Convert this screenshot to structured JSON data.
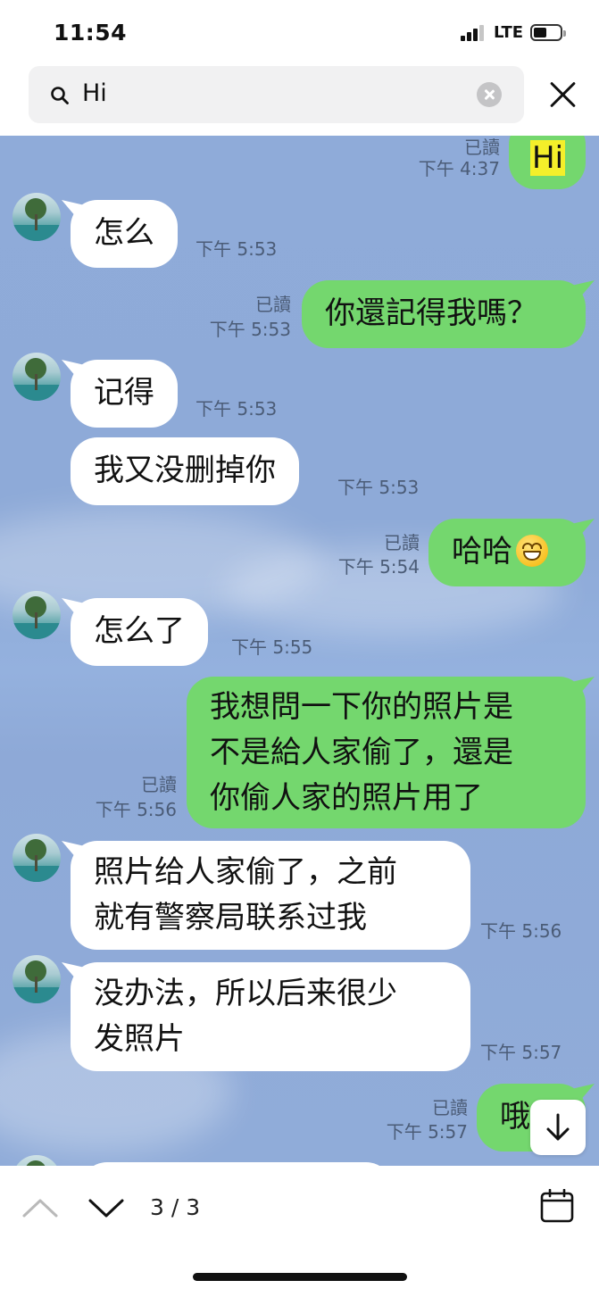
{
  "status_bar": {
    "time": "11:54",
    "network": "LTE"
  },
  "search": {
    "query": "Hi"
  },
  "messages": [
    {
      "side": "out",
      "text": "Hi",
      "read": "已讀",
      "time": "下午 4:37"
    },
    {
      "side": "in",
      "text": "怎么",
      "time": "下午 5:53"
    },
    {
      "side": "out",
      "text": "你還記得我嗎？",
      "read": "已讀",
      "time": "下午 5:53"
    },
    {
      "side": "in",
      "text": "记得",
      "time": "下午 5:53"
    },
    {
      "side": "in",
      "text": "我又没删掉你",
      "time": "下午 5:53"
    },
    {
      "side": "out",
      "text": "哈哈",
      "emoji": "grinning-face-emoji",
      "read": "已讀",
      "time": "下午 5:54"
    },
    {
      "side": "in",
      "text": "怎么了",
      "time": "下午 5:55"
    },
    {
      "side": "out",
      "text": "我想問一下你的照片是\n不是給人家偷了，還是\n你偷人家的照片用了",
      "read": "已讀",
      "time": "下午 5:56"
    },
    {
      "side": "in",
      "text": "照片给人家偷了，之前\n就有警察局联系过我",
      "time": "下午 5:56"
    },
    {
      "side": "in",
      "text": "没办法，所以后来很少\n发照片",
      "time": "下午 5:57"
    },
    {
      "side": "out",
      "text": "哦",
      "read": "已讀",
      "time": "下午 5:57"
    }
  ],
  "footer": {
    "counter": "3 / 3"
  },
  "colors": {
    "outgoing_bubble": "#74d76e",
    "incoming_bubble": "#ffffff",
    "chat_background": "#8fabd9",
    "search_highlight": "#f4ef2a"
  },
  "icons": [
    "search-icon",
    "clear-icon",
    "close-icon",
    "scroll-down-icon",
    "chevron-up-icon",
    "chevron-down-icon",
    "calendar-icon"
  ]
}
